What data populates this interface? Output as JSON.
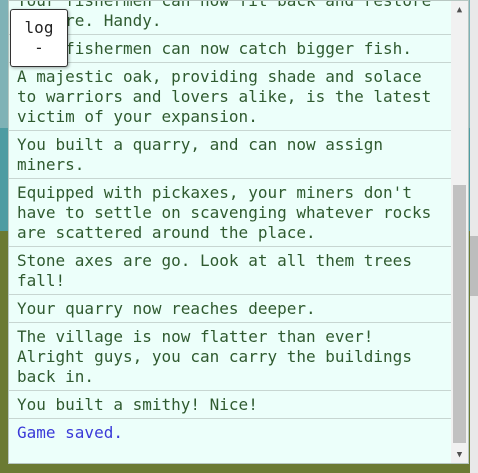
{
  "log_button": {
    "label": "log",
    "collapse_symbol": "-"
  },
  "log_entries": [
    {
      "text": "Your fishermen can now fit back and restore\ncapture. Handy."
    },
    {
      "text": "Your fishermen can now catch bigger fish."
    },
    {
      "text": "A majestic oak, providing shade and solace\nto warriors and lovers alike, is the latest\nvictim of your expansion."
    },
    {
      "text": "You built a quarry, and can now assign\nminers."
    },
    {
      "text": "Equipped with pickaxes, your miners don't\nhave to settle on scavenging whatever rocks\nare scattered around the place."
    },
    {
      "text": "Stone axes are go. Look at all them trees\nfall!"
    },
    {
      "text": "Your quarry now reaches deeper."
    },
    {
      "text": "The village is now flatter than ever!\nAlright guys, you can carry the buildings\nback in."
    },
    {
      "text": "You built a smithy! Nice!"
    },
    {
      "text": "Game saved."
    }
  ],
  "scrollbar": {
    "up_arrow": "▲",
    "down_arrow": "▼"
  },
  "colors": {
    "log_background": "#ecfffa",
    "log_text": "#2f5a2f",
    "saved_text": "#3a3ad8",
    "sky": "#7fb2b6",
    "water": "#4e9ca2",
    "ground": "#6b7a33"
  }
}
